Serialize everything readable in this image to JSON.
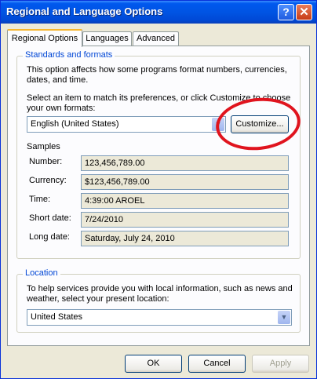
{
  "window": {
    "title": "Regional and Language Options",
    "help_label": "?",
    "close_label": "✕"
  },
  "tabs": [
    {
      "label": "Regional Options",
      "active": true
    },
    {
      "label": "Languages",
      "active": false
    },
    {
      "label": "Advanced",
      "active": false
    }
  ],
  "standards": {
    "legend": "Standards and formats",
    "description": "This option affects how some programs format numbers, currencies, dates, and time.",
    "instruction": "Select an item to match its preferences, or click Customize to choose your own formats:",
    "selected_format": "English (United States)",
    "customize_label": "Customize...",
    "samples_heading": "Samples",
    "samples": [
      {
        "label": "Number:",
        "value": "123,456,789.00"
      },
      {
        "label": "Currency:",
        "value": "$123,456,789.00"
      },
      {
        "label": "Time:",
        "value": "4:39:00 AROEL"
      },
      {
        "label": "Short date:",
        "value": "7/24/2010"
      },
      {
        "label": "Long date:",
        "value": "Saturday, July 24, 2010"
      }
    ]
  },
  "location": {
    "legend": "Location",
    "description": "To help services provide you with local information, such as news and weather, select your present location:",
    "selected_location": "United States"
  },
  "footer": {
    "ok_label": "OK",
    "cancel_label": "Cancel",
    "apply_label": "Apply"
  },
  "annotation": {
    "color": "#e0141e"
  }
}
